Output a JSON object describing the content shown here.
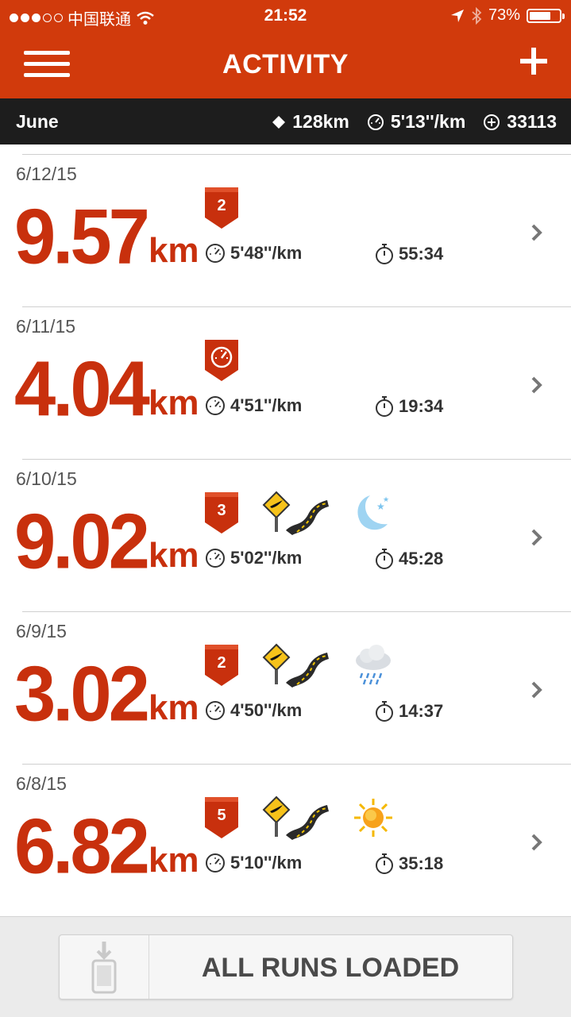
{
  "status_bar": {
    "carrier": "中国联通",
    "time": "21:52",
    "battery": "73%",
    "battery_level": 0.73
  },
  "header": {
    "title": "ACTIVITY"
  },
  "summary": {
    "month": "June",
    "distance": "128km",
    "pace": "5'13''/km",
    "fuel": "33113"
  },
  "runs": [
    {
      "date": "6/12/15",
      "distance": "9.57",
      "unit": "km",
      "badge": "2",
      "badge_icon": "",
      "pace": "5'48''/km",
      "duration": "55:34",
      "extras": []
    },
    {
      "date": "6/11/15",
      "distance": "4.04",
      "unit": "km",
      "badge": "",
      "badge_icon": "speedometer-badge-icon",
      "pace": "4'51''/km",
      "duration": "19:34",
      "extras": []
    },
    {
      "date": "6/10/15",
      "distance": "9.02",
      "unit": "km",
      "badge": "3",
      "badge_icon": "",
      "pace": "5'02''/km",
      "duration": "45:28",
      "extras": [
        "road-sign-icon",
        "moon-icon"
      ]
    },
    {
      "date": "6/9/15",
      "distance": "3.02",
      "unit": "km",
      "badge": "2",
      "badge_icon": "",
      "pace": "4'50''/km",
      "duration": "14:37",
      "extras": [
        "road-sign-icon",
        "rain-cloud-icon"
      ]
    },
    {
      "date": "6/8/15",
      "distance": "6.82",
      "unit": "km",
      "badge": "5",
      "badge_icon": "",
      "pace": "5'10''/km",
      "duration": "35:18",
      "extras": [
        "road-sign-icon",
        "sun-icon"
      ]
    }
  ],
  "footer": {
    "label": "ALL RUNS LOADED"
  },
  "colors": {
    "brand": "#d13a0c",
    "distance": "#c8300d",
    "summary_bg": "#1d1d1d"
  }
}
